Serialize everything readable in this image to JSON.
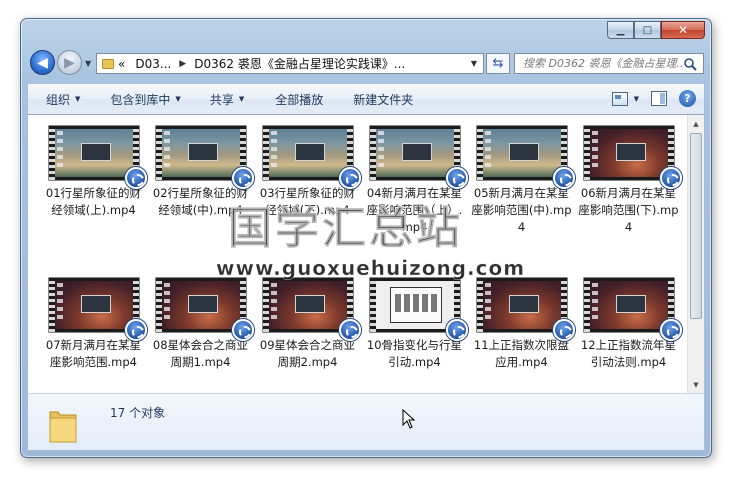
{
  "window": {
    "controls": {
      "minimize": "▁",
      "maximize": "□",
      "close": "✕"
    }
  },
  "nav": {
    "back_glyph": "◀",
    "forward_glyph": "▶",
    "address": {
      "prefix": "«",
      "segments": [
        "D03...",
        "D0362 裘恩《金融占星理论实践课》..."
      ]
    },
    "refresh_glyph": "⇆",
    "search_placeholder": "搜索 D0362 裘恩《金融占星理..."
  },
  "toolbar": {
    "items": [
      "组织",
      "包含到库中",
      "共享",
      "全部播放",
      "新建文件夹"
    ],
    "help_glyph": "?"
  },
  "files": [
    {
      "name": "01行星所象征的财经领域(上).mp4",
      "scene": "ocean"
    },
    {
      "name": "02行星所象征的财经领域(中).mp4",
      "scene": "ocean"
    },
    {
      "name": "03行星所象征的财经领域(下).mp4",
      "scene": "ocean"
    },
    {
      "name": "04新月满月在某星座影响范围（上）.mp4",
      "scene": "ocean"
    },
    {
      "name": "05新月满月在某星座影响范围(中).mp4",
      "scene": "ocean"
    },
    {
      "name": "06新月满月在某星座影响范围(下).mp4",
      "scene": "red"
    },
    {
      "name": "07新月满月在某星座影响范围.mp4",
      "scene": "red"
    },
    {
      "name": "08星体会合之商业周期1.mp4",
      "scene": "red"
    },
    {
      "name": "09星体会合之商业周期2.mp4",
      "scene": "red"
    },
    {
      "name": "10骨指变化与行星引动.mp4",
      "scene": "white"
    },
    {
      "name": "11上正指数次限盘应用.mp4",
      "scene": "red"
    },
    {
      "name": "12上正指数流年星引动法则.mp4",
      "scene": "red"
    }
  ],
  "watermark": {
    "title": "国学汇总站",
    "url": "www.guoxuehuizong.com"
  },
  "details": {
    "count": "17 个对象"
  },
  "colors": {
    "accent": "#1e395b",
    "frame": "#a9c4e0"
  }
}
